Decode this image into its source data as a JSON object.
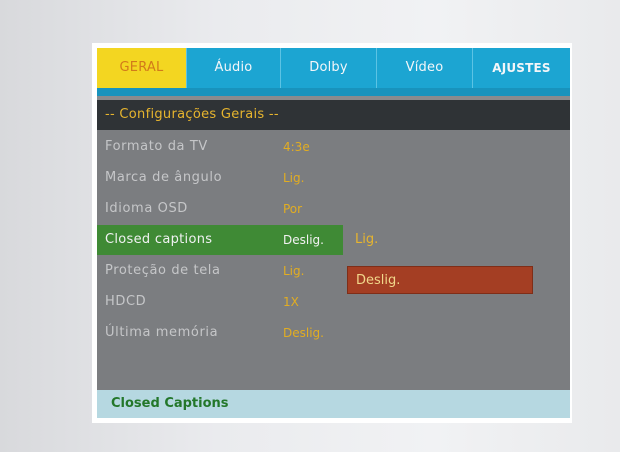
{
  "tabs": [
    {
      "label": "GERAL",
      "active": true
    },
    {
      "label": "Áudio",
      "active": false
    },
    {
      "label": "Dolby",
      "active": false
    },
    {
      "label": "Vídeo",
      "active": false
    },
    {
      "label": "AJUSTES",
      "active": false
    }
  ],
  "section_title": "-- Configurações Gerais --",
  "settings": [
    {
      "label": "Formato da TV",
      "value": "4:3e"
    },
    {
      "label": "Marca de ângulo",
      "value": "Lig."
    },
    {
      "label": "Idioma OSD",
      "value": "Por"
    },
    {
      "label": "Closed captions",
      "value": "Deslig."
    },
    {
      "label": "Proteção de tela",
      "value": "Lig."
    },
    {
      "label": "HDCD",
      "value": "1X"
    },
    {
      "label": "Última memória",
      "value": "Deslig."
    }
  ],
  "dropdown_options": [
    "Lig.",
    "Deslig."
  ],
  "status_text": "Closed Captions",
  "colors": {
    "tab_bar": "#1ca5d2",
    "active_tab": "#f3d621",
    "selected_row": "#3f8a35",
    "highlight_option": "#a43e23",
    "value_text": "#e2ad22",
    "status_bar": "#b6d8e1"
  }
}
